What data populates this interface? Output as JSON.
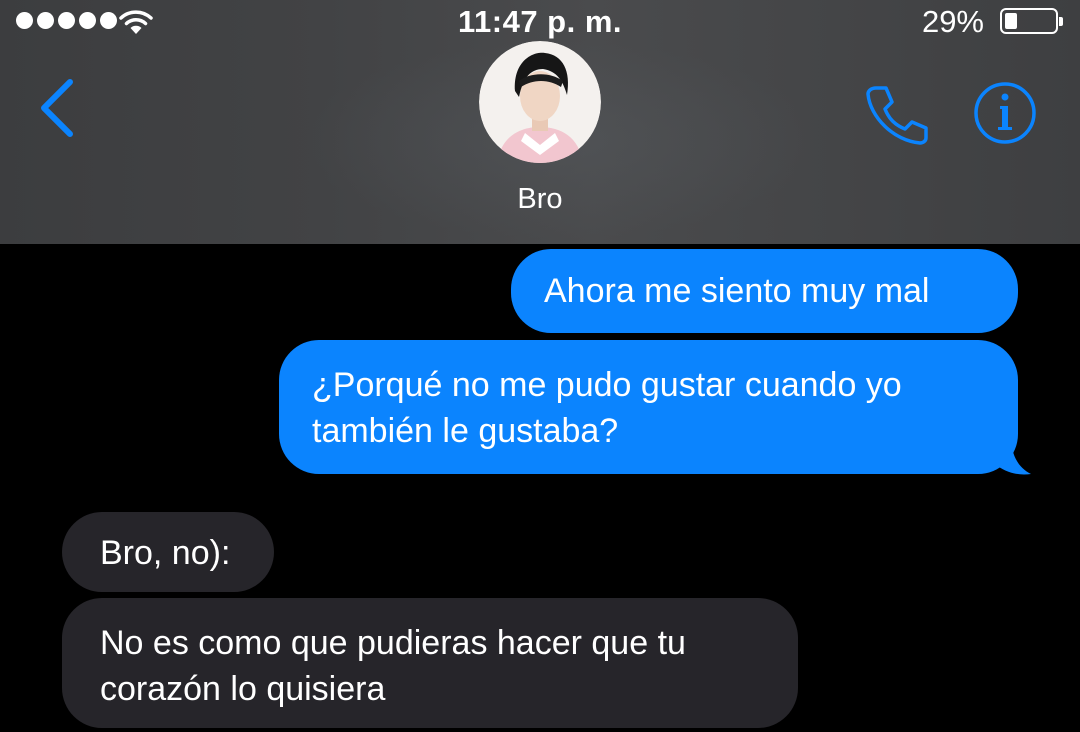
{
  "status_bar": {
    "time": "11:47 p. m.",
    "battery_percent": "29%",
    "battery_level": 0.29,
    "signal_bars": 5
  },
  "header": {
    "contact_name": "Bro",
    "back_icon": "chevron-left-icon",
    "call_icon": "phone-icon",
    "info_icon": "info-icon",
    "accent_color": "#0b84fe"
  },
  "messages": [
    {
      "direction": "outgoing",
      "text": "Ahora me siento muy mal"
    },
    {
      "direction": "outgoing",
      "lines": [
        "¿Porqué no me pudo gustar cuando yo",
        "también le gustaba?"
      ]
    },
    {
      "direction": "incoming",
      "text": "Bro, no):"
    },
    {
      "direction": "incoming",
      "lines": [
        "No es como que pudieras hacer que tu",
        "corazón lo quisiera"
      ]
    }
  ],
  "colors": {
    "outgoing_bubble": "#0b84fe",
    "incoming_bubble": "#26252a",
    "background": "#000000"
  }
}
